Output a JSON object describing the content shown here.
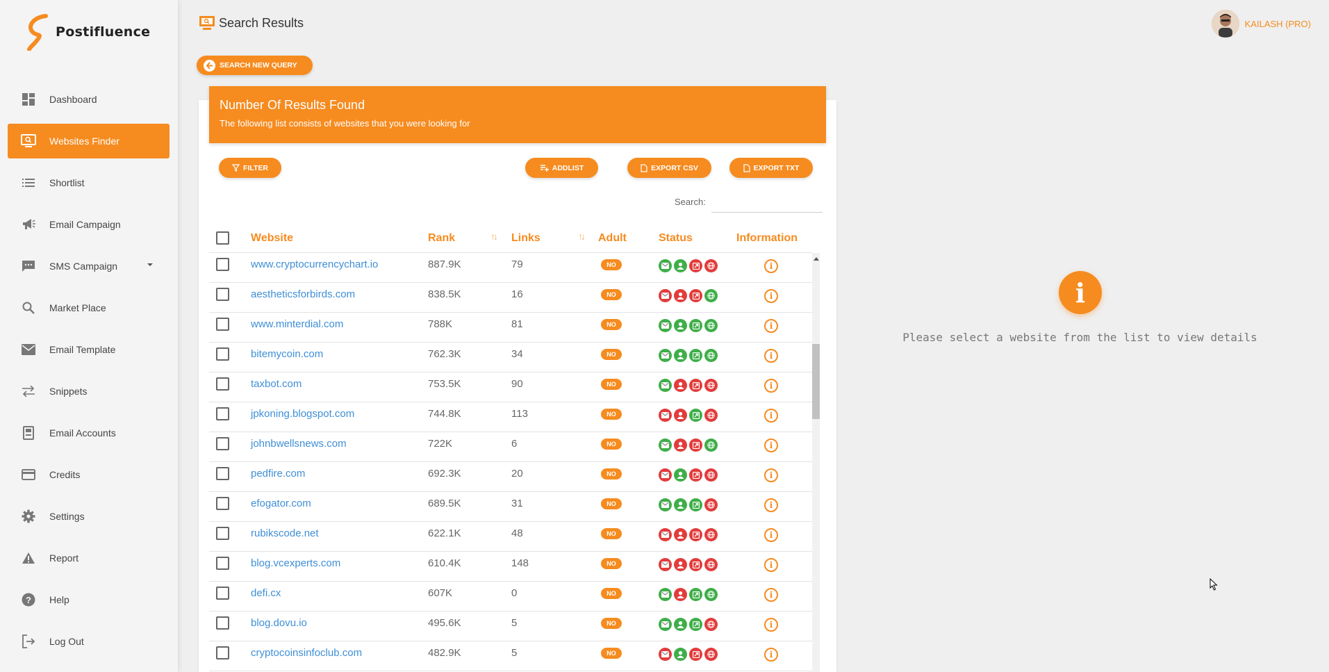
{
  "app": {
    "name": "Postifluence",
    "brand_color": "#f68b1f"
  },
  "header": {
    "title": "Search Results",
    "user": "KAILASH (PRO)"
  },
  "sidebar": {
    "items": [
      {
        "label": "Dashboard",
        "icon": "dashboard-icon"
      },
      {
        "label": "Websites Finder",
        "icon": "monitor-search-icon",
        "active": true
      },
      {
        "label": "Shortlist",
        "icon": "list-icon"
      },
      {
        "label": "Email Campaign",
        "icon": "megaphone-icon"
      },
      {
        "label": "SMS Campaign",
        "icon": "chat-icon",
        "expandable": true
      },
      {
        "label": "Market Place",
        "icon": "search-icon"
      },
      {
        "label": "Email Template",
        "icon": "mail-icon"
      },
      {
        "label": "Snippets",
        "icon": "swap-icon"
      },
      {
        "label": "Email Accounts",
        "icon": "document-icon"
      },
      {
        "label": "Credits",
        "icon": "credit-card-icon"
      },
      {
        "label": "Settings",
        "icon": "gear-icon"
      },
      {
        "label": "Report",
        "icon": "warning-icon"
      },
      {
        "label": "Help",
        "icon": "help-icon"
      },
      {
        "label": "Log Out",
        "icon": "logout-icon"
      }
    ]
  },
  "toolbar": {
    "new_query": "SEARCH NEW QUERY",
    "filter": "FILTER",
    "addlist": "ADDLIST",
    "export_csv": "EXPORT CSV",
    "export_txt": "EXPORT TXT",
    "search_label": "Search:"
  },
  "banner": {
    "title": "Number Of Results Found",
    "subtitle": "The following list consists of websites that you were looking for"
  },
  "table": {
    "columns": [
      "Website",
      "Rank",
      "Links",
      "Adult",
      "Status",
      "Information"
    ],
    "rows": [
      {
        "website": "www.cryptocurrencychart.io",
        "rank": "887.9K",
        "links": "79",
        "adult": "NO",
        "status": [
          "g",
          "g",
          "r",
          "r"
        ]
      },
      {
        "website": "aestheticsforbirds.com",
        "rank": "838.5K",
        "links": "16",
        "adult": "NO",
        "status": [
          "r",
          "r",
          "r",
          "g"
        ]
      },
      {
        "website": "www.minterdial.com",
        "rank": "788K",
        "links": "81",
        "adult": "NO",
        "status": [
          "g",
          "g",
          "g",
          "g"
        ]
      },
      {
        "website": "bitemycoin.com",
        "rank": "762.3K",
        "links": "34",
        "adult": "NO",
        "status": [
          "g",
          "g",
          "g",
          "g"
        ]
      },
      {
        "website": "taxbot.com",
        "rank": "753.5K",
        "links": "90",
        "adult": "NO",
        "status": [
          "g",
          "r",
          "r",
          "r"
        ]
      },
      {
        "website": "jpkoning.blogspot.com",
        "rank": "744.8K",
        "links": "113",
        "adult": "NO",
        "status": [
          "r",
          "r",
          "g",
          "r"
        ]
      },
      {
        "website": "johnbwellsnews.com",
        "rank": "722K",
        "links": "6",
        "adult": "NO",
        "status": [
          "g",
          "r",
          "r",
          "g"
        ]
      },
      {
        "website": "pedfire.com",
        "rank": "692.3K",
        "links": "20",
        "adult": "NO",
        "status": [
          "r",
          "g",
          "r",
          "r"
        ]
      },
      {
        "website": "efogator.com",
        "rank": "689.5K",
        "links": "31",
        "adult": "NO",
        "status": [
          "g",
          "g",
          "g",
          "r"
        ]
      },
      {
        "website": "rubikscode.net",
        "rank": "622.1K",
        "links": "48",
        "adult": "NO",
        "status": [
          "r",
          "r",
          "r",
          "r"
        ]
      },
      {
        "website": "blog.vcexperts.com",
        "rank": "610.4K",
        "links": "148",
        "adult": "NO",
        "status": [
          "r",
          "r",
          "r",
          "r"
        ]
      },
      {
        "website": "defi.cx",
        "rank": "607K",
        "links": "0",
        "adult": "NO",
        "status": [
          "g",
          "r",
          "g",
          "g"
        ]
      },
      {
        "website": "blog.dovu.io",
        "rank": "495.6K",
        "links": "5",
        "adult": "NO",
        "status": [
          "g",
          "g",
          "g",
          "r"
        ]
      },
      {
        "website": "cryptocoinsinfoclub.com",
        "rank": "482.9K",
        "links": "5",
        "adult": "NO",
        "status": [
          "r",
          "g",
          "r",
          "r"
        ]
      }
    ]
  },
  "detail": {
    "message": "Please select a website from the list to view details"
  }
}
